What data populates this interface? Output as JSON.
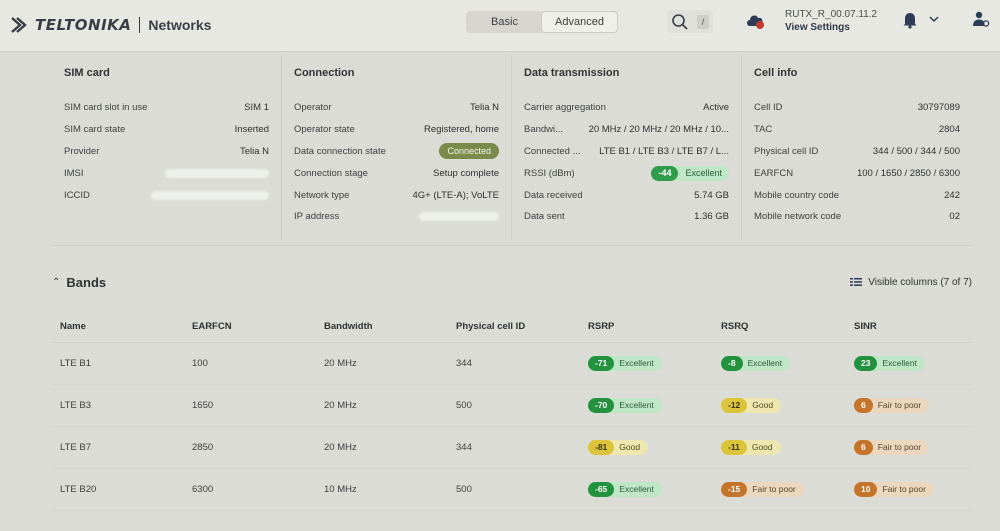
{
  "header": {
    "brand": "TELTONIKA",
    "product": "Networks",
    "modes": [
      "Basic",
      "Advanced"
    ],
    "active_mode": "Advanced",
    "search_shortcut": "/",
    "firmware_version": "RUTX_R_00.07.11.2",
    "view_settings": "View Settings"
  },
  "summary": {
    "sim": {
      "title": "SIM card",
      "rows": [
        {
          "k": "SIM card slot in use",
          "v": "SIM 1"
        },
        {
          "k": "SIM card state",
          "v": "Inserted"
        },
        {
          "k": "Provider",
          "v": "Telia N"
        },
        {
          "k": "IMSI",
          "v": ""
        },
        {
          "k": "ICCID",
          "v": ""
        }
      ]
    },
    "connection": {
      "title": "Connection",
      "rows": [
        {
          "k": "Operator",
          "v": "Telia N"
        },
        {
          "k": "Operator state",
          "v": "Registered, home"
        },
        {
          "k": "Data connection state",
          "v": "Connected"
        },
        {
          "k": "Connection stage",
          "v": "Setup complete"
        },
        {
          "k": "Network type",
          "v": "4G+ (LTE-A); VoLTE"
        },
        {
          "k": "IP address",
          "v": ""
        }
      ]
    },
    "data": {
      "title": "Data transmission",
      "rows": [
        {
          "k": "Carrier aggregation",
          "v": "Active"
        },
        {
          "k": "Bandwi...",
          "v": "20 MHz / 20 MHz / 20 MHz / 10..."
        },
        {
          "k": "Connected ...",
          "v": "LTE B1 / LTE B3 / LTE B7 / L..."
        },
        {
          "k": "RSSI (dBm)",
          "v": "-44",
          "quality": "Excellent"
        },
        {
          "k": "Data received",
          "v": "5.74 GB"
        },
        {
          "k": "Data sent",
          "v": "1.36 GB"
        }
      ]
    },
    "cell": {
      "title": "Cell info",
      "rows": [
        {
          "k": "Cell ID",
          "v": "30797089"
        },
        {
          "k": "TAC",
          "v": "2804"
        },
        {
          "k": "Physical cell ID",
          "v": "344 / 500 / 344 / 500"
        },
        {
          "k": "EARFCN",
          "v": "100 / 1650 / 2850 / 6300"
        },
        {
          "k": "Mobile country code",
          "v": "242"
        },
        {
          "k": "Mobile network code",
          "v": "02"
        }
      ]
    }
  },
  "bands": {
    "title": "Bands",
    "visible_columns": "Visible columns (7 of 7)",
    "columns": [
      "Name",
      "EARFCN",
      "Bandwidth",
      "Physical cell ID",
      "RSRP",
      "RSRQ",
      "SINR"
    ],
    "rows": [
      {
        "name": "LTE B1",
        "earfcn": "100",
        "bandwidth": "20 MHz",
        "pci": "344",
        "rsrp": {
          "v": "-71",
          "q": "Excellent"
        },
        "rsrq": {
          "v": "-8",
          "q": "Excellent"
        },
        "sinr": {
          "v": "23",
          "q": "Excellent"
        }
      },
      {
        "name": "LTE B3",
        "earfcn": "1650",
        "bandwidth": "20 MHz",
        "pci": "500",
        "rsrp": {
          "v": "-70",
          "q": "Excellent"
        },
        "rsrq": {
          "v": "-12",
          "q": "Good"
        },
        "sinr": {
          "v": "6",
          "q": "Fair to poor"
        }
      },
      {
        "name": "LTE B7",
        "earfcn": "2850",
        "bandwidth": "20 MHz",
        "pci": "344",
        "rsrp": {
          "v": "-81",
          "q": "Good"
        },
        "rsrq": {
          "v": "-11",
          "q": "Good"
        },
        "sinr": {
          "v": "6",
          "q": "Fair to poor"
        }
      },
      {
        "name": "LTE B20",
        "earfcn": "6300",
        "bandwidth": "10 MHz",
        "pci": "500",
        "rsrp": {
          "v": "-65",
          "q": "Excellent"
        },
        "rsrq": {
          "v": "-15",
          "q": "Fair to poor"
        },
        "sinr": {
          "v": "10",
          "q": "Fair to poor"
        }
      }
    ]
  },
  "colors": {
    "excellent": "#23923f",
    "good": "#dcc43a",
    "fair_to_poor": "#c5742c",
    "connected": "#7a8a4a"
  }
}
